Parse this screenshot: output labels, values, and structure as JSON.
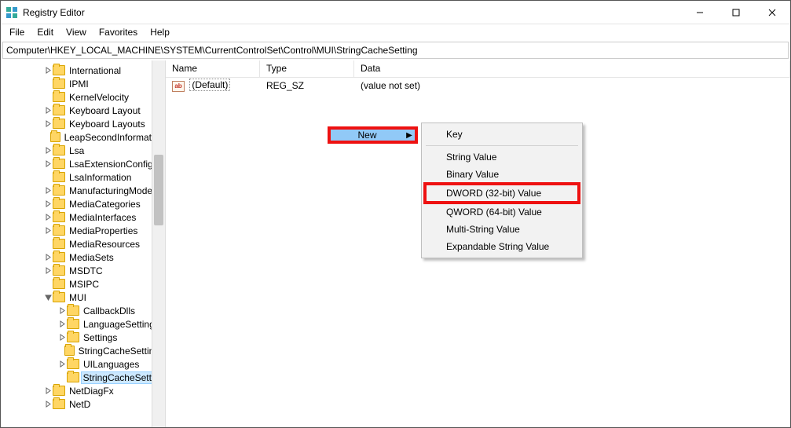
{
  "title": "Registry Editor",
  "menu": {
    "file": "File",
    "edit": "Edit",
    "view": "View",
    "favorites": "Favorites",
    "help": "Help"
  },
  "address": "Computer\\HKEY_LOCAL_MACHINE\\SYSTEM\\CurrentControlSet\\Control\\MUI\\StringCacheSetting",
  "tree": [
    {
      "label": "International",
      "depth": 2,
      "exp": "closed"
    },
    {
      "label": "IPMI",
      "depth": 2,
      "exp": "none"
    },
    {
      "label": "KernelVelocity",
      "depth": 2,
      "exp": "none"
    },
    {
      "label": "Keyboard Layout",
      "depth": 2,
      "exp": "closed"
    },
    {
      "label": "Keyboard Layouts",
      "depth": 2,
      "exp": "closed"
    },
    {
      "label": "LeapSecondInformation",
      "depth": 2,
      "exp": "none"
    },
    {
      "label": "Lsa",
      "depth": 2,
      "exp": "closed"
    },
    {
      "label": "LsaExtensionConfig",
      "depth": 2,
      "exp": "closed"
    },
    {
      "label": "LsaInformation",
      "depth": 2,
      "exp": "none"
    },
    {
      "label": "ManufacturingMode",
      "depth": 2,
      "exp": "closed"
    },
    {
      "label": "MediaCategories",
      "depth": 2,
      "exp": "closed"
    },
    {
      "label": "MediaInterfaces",
      "depth": 2,
      "exp": "closed"
    },
    {
      "label": "MediaProperties",
      "depth": 2,
      "exp": "closed"
    },
    {
      "label": "MediaResources",
      "depth": 2,
      "exp": "none"
    },
    {
      "label": "MediaSets",
      "depth": 2,
      "exp": "closed"
    },
    {
      "label": "MSDTC",
      "depth": 2,
      "exp": "closed"
    },
    {
      "label": "MSIPC",
      "depth": 2,
      "exp": "none"
    },
    {
      "label": "MUI",
      "depth": 2,
      "exp": "open"
    },
    {
      "label": "CallbackDlls",
      "depth": 3,
      "exp": "closed"
    },
    {
      "label": "LanguageSettings",
      "depth": 3,
      "exp": "closed"
    },
    {
      "label": "Settings",
      "depth": 3,
      "exp": "closed"
    },
    {
      "label": "StringCacheSettings",
      "depth": 3,
      "exp": "none"
    },
    {
      "label": "UILanguages",
      "depth": 3,
      "exp": "closed"
    },
    {
      "label": "StringCacheSetting",
      "depth": 3,
      "exp": "none",
      "selected": true
    },
    {
      "label": "NetDiagFx",
      "depth": 2,
      "exp": "closed"
    },
    {
      "label": "NetD",
      "depth": 2,
      "exp": "closed"
    }
  ],
  "columns": {
    "name": "Name",
    "type": "Type",
    "data": "Data"
  },
  "values": [
    {
      "name": "(Default)",
      "type": "REG_SZ",
      "data": "(value not set)"
    }
  ],
  "context": {
    "new": "New",
    "items": [
      {
        "label": "Key",
        "sep_after": true
      },
      {
        "label": "String Value"
      },
      {
        "label": "Binary Value"
      },
      {
        "label": "DWORD (32-bit) Value",
        "highlight": true
      },
      {
        "label": "QWORD (64-bit) Value"
      },
      {
        "label": "Multi-String Value"
      },
      {
        "label": "Expandable String Value"
      }
    ]
  }
}
